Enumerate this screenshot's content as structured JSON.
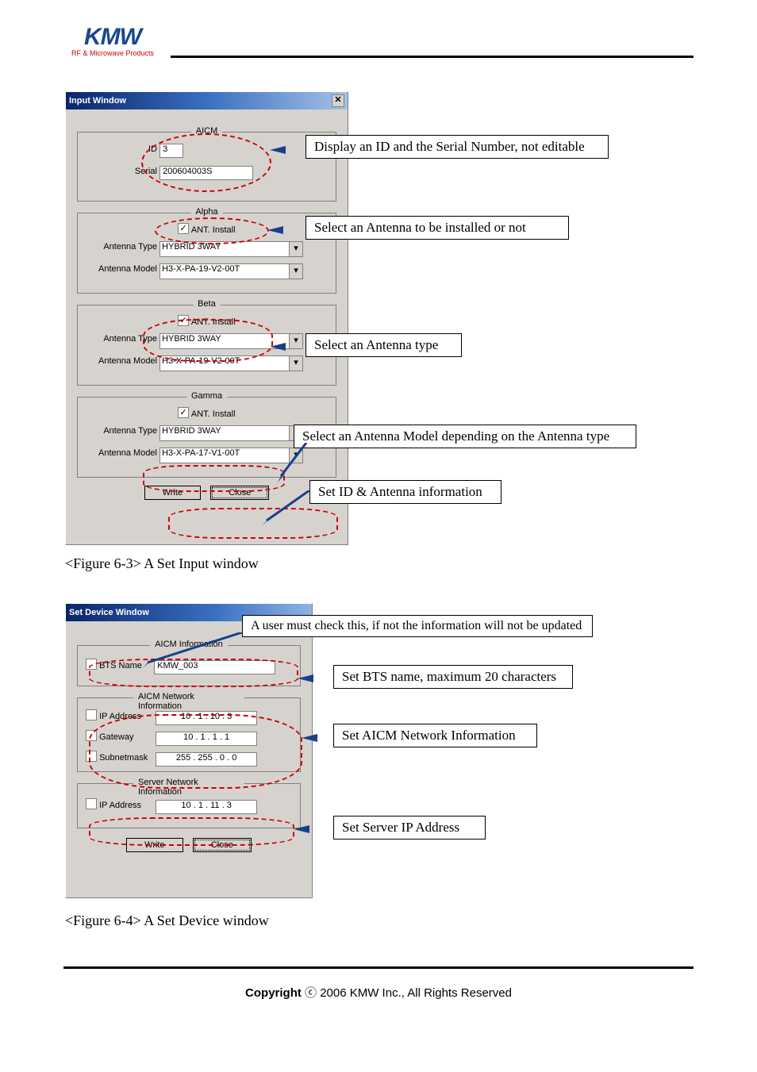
{
  "header": {
    "logo_main": "KMW",
    "logo_sub": "RF & Microwave Products"
  },
  "fig63": {
    "window_title": "Input Window",
    "caption": "<Figure 6-3> A Set Input window",
    "groups": {
      "aicm": {
        "title": "AICM",
        "id_label": "ID",
        "id_value": "3",
        "serial_label": "Serial",
        "serial_value": "200604003S"
      },
      "alpha": {
        "title": "Alpha",
        "ant_install_label": "ANT. Install",
        "ant_type_label": "Antenna Type",
        "ant_type_value": "HYBRID 3WAY",
        "ant_model_label": "Antenna Model",
        "ant_model_value": "H3-X-PA-19-V2-00T"
      },
      "beta": {
        "title": "Beta",
        "ant_install_label": "ANT. Install",
        "ant_type_label": "Antenna Type",
        "ant_type_value": "HYBRID 3WAY",
        "ant_model_label": "Antenna Model",
        "ant_model_value": "H3-X-PA-19-V2-00T"
      },
      "gamma": {
        "title": "Gamma",
        "ant_install_label": "ANT. Install",
        "ant_type_label": "Antenna Type",
        "ant_type_value": "HYBRID 3WAY",
        "ant_model_label": "Antenna Model",
        "ant_model_value": "H3-X-PA-17-V1-00T"
      }
    },
    "buttons": {
      "write": "Write",
      "close": "Close"
    },
    "callouts": {
      "c1": "Display an ID and the Serial Number, not editable",
      "c2": "Select an Antenna to be installed or not",
      "c3": "Select an Antenna type",
      "c4": "Select an Antenna Model depending on the Antenna type",
      "c5": "Set ID & Antenna information"
    }
  },
  "fig64": {
    "window_title": "Set Device Window",
    "caption": "<Figure 6-4> A Set Device window",
    "groups": {
      "aicm_info": {
        "title": "AICM Information",
        "bts_name_label": "BTS Name",
        "bts_name_value": "KMW_003"
      },
      "net_info": {
        "title": "AICM Network Information",
        "ip_label": "IP Address",
        "ip_value": "10 .   1  . 10 .   3",
        "gw_label": "Gateway",
        "gw_value": "10 .   1  .   1  .   1",
        "mask_label": "Subnetmask",
        "mask_value": "255 . 255 .   0  .   0"
      },
      "srv_info": {
        "title": "Server Network Information",
        "ip_label": "IP Address",
        "ip_value": "10 .   1  . 11 .   3"
      }
    },
    "buttons": {
      "write": "Write",
      "close": "Close"
    },
    "callouts": {
      "c1": "A user must check this, if not the information will not be updated",
      "c2": "Set BTS name, maximum 20 characters",
      "c3": "Set AICM Network Information",
      "c4": "Set Server IP Address"
    }
  },
  "footer": {
    "copyright_bold": "Copyright",
    "copyright_rest": " ⓒ 2006 KMW Inc., All Rights Reserved"
  }
}
